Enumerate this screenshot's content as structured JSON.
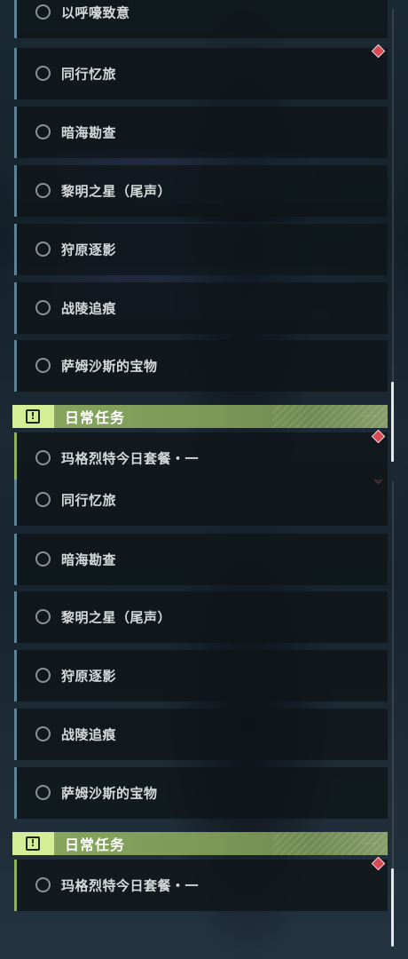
{
  "panels": [
    {
      "story_quests": [
        {
          "label": "以呼嚎致意"
        },
        {
          "label": "同行忆旅"
        },
        {
          "label": "暗海勘查"
        },
        {
          "label": "黎明之星（尾声）"
        },
        {
          "label": "狩原逐影"
        },
        {
          "label": "战陵追痕"
        },
        {
          "label": "萨姆沙斯的宝物"
        }
      ],
      "daily_header": {
        "title": "日常任务"
      },
      "daily_quests": [
        {
          "label": "玛格烈特今日套餐・一"
        }
      ]
    },
    {
      "story_quests": [
        {
          "label": "同行忆旅"
        },
        {
          "label": "暗海勘查"
        },
        {
          "label": "黎明之星（尾声）"
        },
        {
          "label": "狩原逐影"
        },
        {
          "label": "战陵追痕"
        },
        {
          "label": "萨姆沙斯的宝物"
        }
      ],
      "daily_header": {
        "title": "日常任务"
      },
      "daily_quests": [
        {
          "label": "玛格烈特今日套餐・一"
        }
      ]
    }
  ],
  "colors": {
    "story_accent": "#5d8294",
    "daily_accent": "#8cae62",
    "daily_header_bg": "#8aa861",
    "daily_badge_bg": "#d4ee98",
    "notification": "#d84a55"
  },
  "icons": {
    "quest_status": "empty-circle-icon",
    "daily_badge": "exclamation-box-icon",
    "notification": "red-diamond-icon"
  }
}
